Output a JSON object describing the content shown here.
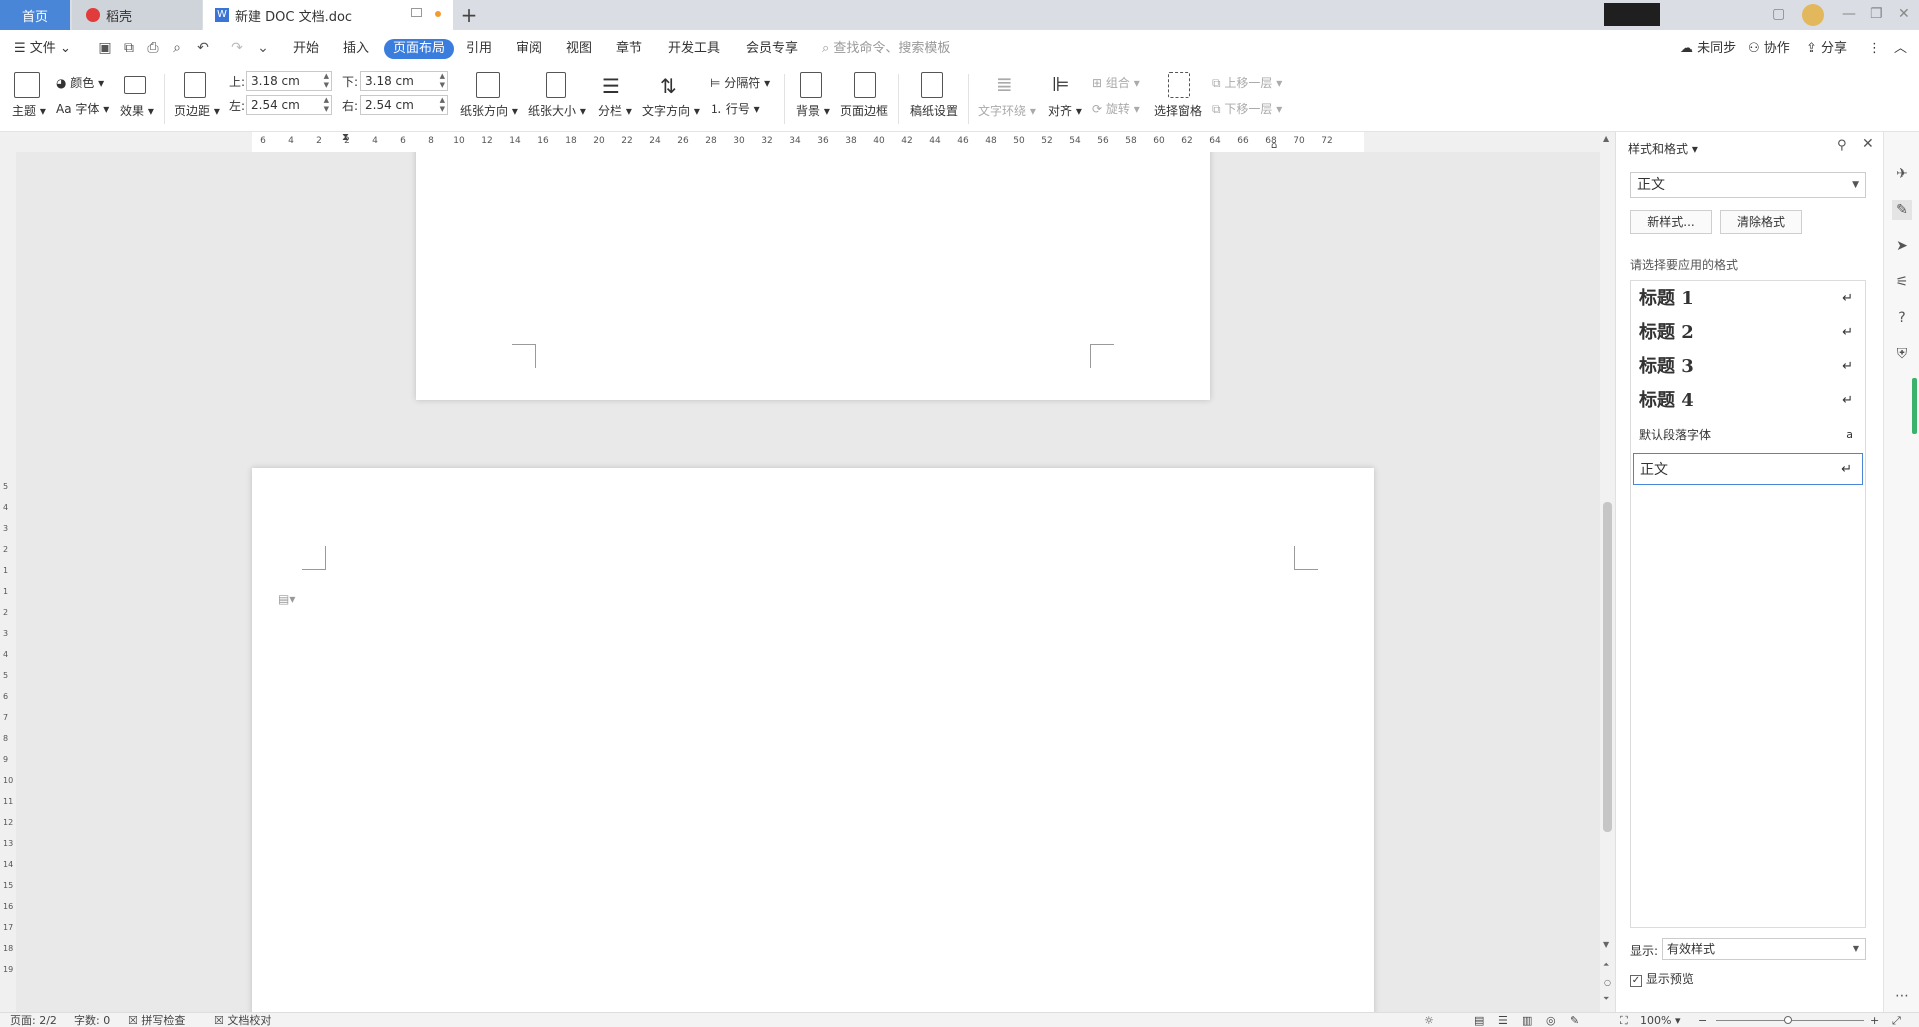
{
  "tabs": {
    "home": "首页",
    "daoke": "稻壳",
    "doc": "新建 DOC 文档.doc"
  },
  "menu": {
    "file": "文件",
    "items": [
      "开始",
      "插入",
      "页面布局",
      "引用",
      "审阅",
      "视图",
      "章节",
      "开发工具",
      "会员专享"
    ],
    "search_placeholder": "查找命令、搜索模板",
    "sync": "未同步",
    "collab": "协作",
    "share": "分享"
  },
  "ribbon": {
    "theme": "主题",
    "color": "颜色",
    "font": "字体",
    "effect": "效果",
    "margins": "页边距",
    "top_label": "上:",
    "top_val": "3.18 cm",
    "bottom_label": "下:",
    "bottom_val": "3.18 cm",
    "left_label": "左:",
    "left_val": "2.54 cm",
    "right_label": "右:",
    "right_val": "2.54 cm",
    "orientation": "纸张方向",
    "size": "纸张大小",
    "columns": "分栏",
    "text_dir": "文字方向",
    "separator": "分隔符",
    "line_no": "行号",
    "background": "背景",
    "page_border": "页面边框",
    "draft_setting": "稿纸设置",
    "text_wrap": "文字环绕",
    "align": "对齐",
    "group": "组合",
    "rotate": "旋转",
    "select_pane": "选择窗格",
    "bring_forward": "上移一层",
    "send_backward": "下移一层"
  },
  "ruler_h": [
    "6",
    "4",
    "2",
    "2",
    "4",
    "6",
    "8",
    "10",
    "12",
    "14",
    "16",
    "18",
    "20",
    "22",
    "24",
    "26",
    "28",
    "30",
    "32",
    "34",
    "36",
    "38",
    "40",
    "42",
    "44",
    "46",
    "48",
    "50",
    "52",
    "54",
    "56",
    "58",
    "60",
    "62",
    "64",
    "66",
    "68",
    "70",
    "72"
  ],
  "ruler_v": [
    "5",
    "4",
    "3",
    "2",
    "1",
    "1",
    "2",
    "3",
    "4",
    "5",
    "6",
    "7",
    "8",
    "9",
    "10",
    "11",
    "12",
    "13",
    "14",
    "15",
    "16",
    "17",
    "18",
    "19"
  ],
  "panel": {
    "title": "样式和格式",
    "current_style": "正文",
    "new_style": "新样式...",
    "clear_format": "清除格式",
    "prompt": "请选择要应用的格式",
    "styles": [
      {
        "label": "标题  1",
        "mark": "↵"
      },
      {
        "label": "标题  2",
        "mark": "↵"
      },
      {
        "label": "标题  3",
        "mark": "↵"
      },
      {
        "label": "标题  4",
        "mark": "↵"
      },
      {
        "label": "默认段落字体",
        "mark": "a"
      },
      {
        "label": "正文",
        "mark": "↵"
      }
    ],
    "show_label": "显示:",
    "show_value": "有效样式",
    "preview_label": "显示预览"
  },
  "status": {
    "page": "页面: 2/2",
    "words": "字数: 0",
    "spell": "拼写检查",
    "proof": "文档校对",
    "zoom": "100%"
  }
}
